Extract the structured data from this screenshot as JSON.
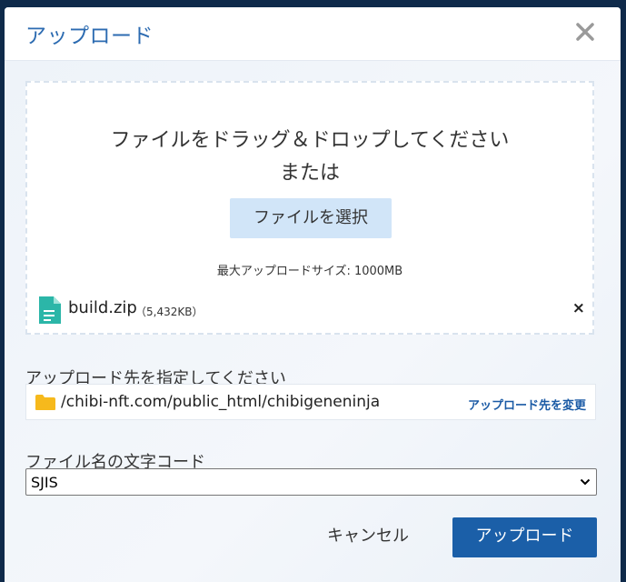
{
  "dialog": {
    "title": "アップロード",
    "close_icon": "close-icon"
  },
  "dropzone": {
    "line1": "ファイルをドラッグ＆ドロップしてください",
    "line2": "または",
    "select_button": "ファイルを選択",
    "max_size": "最大アップロードサイズ: 1000MB"
  },
  "file": {
    "icon": "file-icon",
    "name": "build.zip",
    "size": "（5,432KB）",
    "remove_icon": "×"
  },
  "destination": {
    "label": "アップロード先を指定してください",
    "folder_icon": "folder-icon",
    "path": "/chibi-nft.com/public_html/chibigeneninja",
    "change_link": "アップロード先を変更"
  },
  "encoding": {
    "label": "ファイル名の文字コード",
    "selected": "SJIS"
  },
  "actions": {
    "cancel": "キャンセル",
    "upload": "アップロード"
  },
  "colors": {
    "accent": "#1b5fa8",
    "title": "#2c6bb1",
    "file_icon": "#2bb6a8",
    "folder_icon": "#f6b91c"
  }
}
